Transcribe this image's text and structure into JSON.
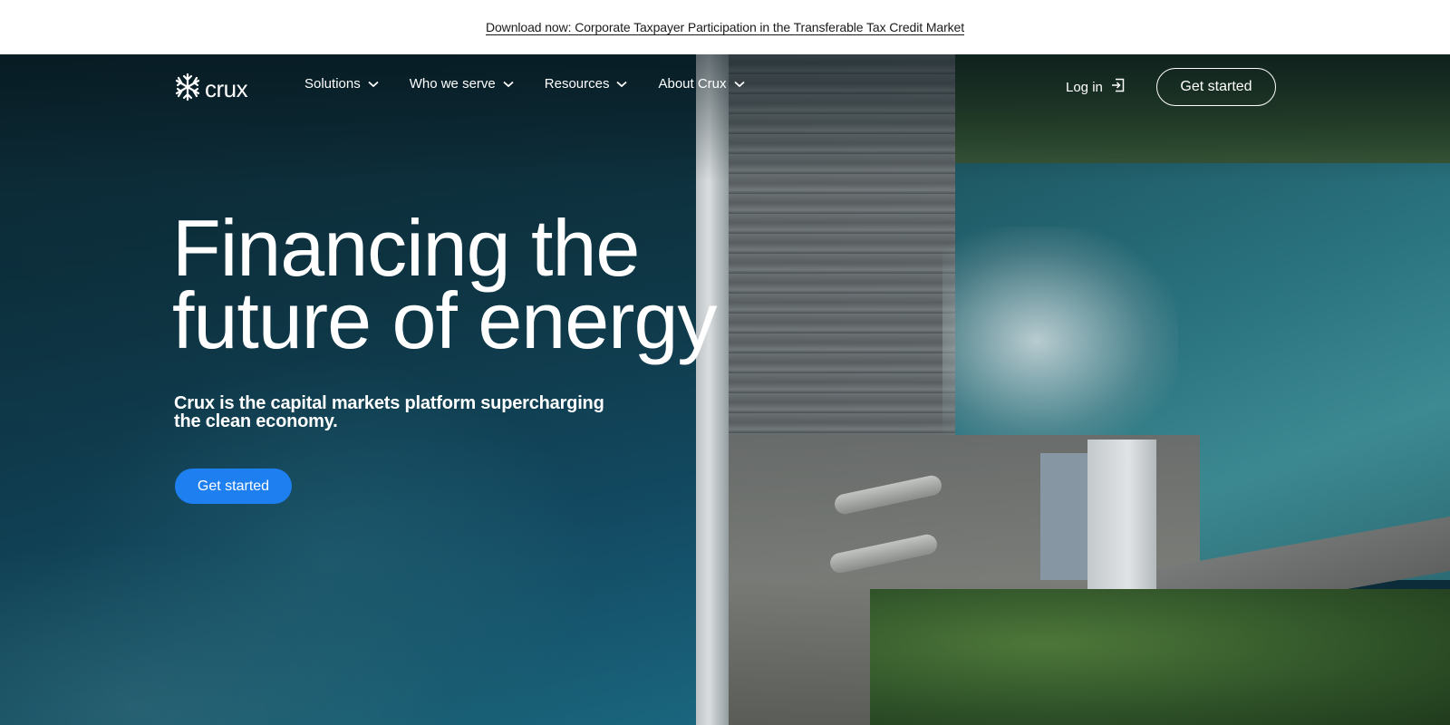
{
  "announcement": {
    "text": "Download now: Corporate Taxpayer Participation in the Transferable Tax Credit Market"
  },
  "brand": {
    "name": "crux",
    "logo_icon": "crux-snowflake-icon"
  },
  "nav": {
    "items": [
      {
        "label": "Solutions",
        "icon": "chevron-down-icon"
      },
      {
        "label": "Who we serve",
        "icon": "chevron-down-icon"
      },
      {
        "label": "Resources",
        "icon": "chevron-down-icon"
      },
      {
        "label": "About Crux",
        "icon": "chevron-down-icon"
      }
    ],
    "login_label": "Log in",
    "login_icon": "login-arrow-icon",
    "cta_label": "Get started"
  },
  "hero": {
    "headline_line1": "Financing the",
    "headline_line2": "future of energy",
    "subhead": "Crux is the capital markets platform supercharging the clean economy.",
    "cta_label": "Get started",
    "background": "aerial-dam-photo"
  },
  "colors": {
    "accent": "#1e7ff0",
    "text_on_dark": "#ffffff",
    "announcement_bg": "#ffffff"
  }
}
